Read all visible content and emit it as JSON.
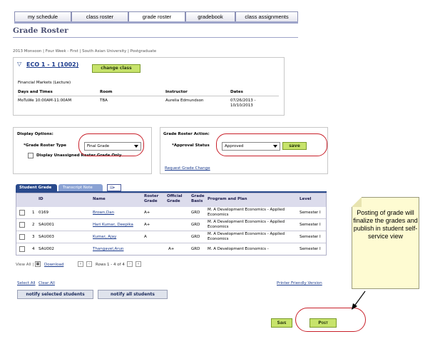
{
  "nav": {
    "tabs": [
      "my schedule",
      "class roster",
      "grade roster",
      "gradebook",
      "class assignments"
    ]
  },
  "page": {
    "title": "Grade Roster",
    "term": "2013 Monsoon | Four Week - First | South Asian University | Postgraduate"
  },
  "course": {
    "code": "ECO 1 - 1 (1002)",
    "change_class": "change class",
    "description": "Financial Markets (Lecture)",
    "headers": [
      "Days and Times",
      "Room",
      "Instructor",
      "Dates"
    ],
    "days_times": "MoTuWe 10:00AM-11:00AM",
    "room": "TBA",
    "instructor": "Aurelia Edmundson",
    "dates_1": "07/26/2013 -",
    "dates_2": "10/10/2013"
  },
  "display_options": {
    "heading": "Display Options:",
    "type_label": "*Grade Roster Type",
    "type_value": "Final Grade",
    "unassigned_label": "Display Unassigned Roster Grade Only"
  },
  "roster_action": {
    "heading": "Grade Roster Action:",
    "status_label": "*Approval Status",
    "status_value": "Approved",
    "save_label": "save",
    "request_change": "Request Grade Change"
  },
  "grid": {
    "tabs": [
      "Student Grade",
      "Transcript Note"
    ],
    "columns": [
      "ID",
      "Name",
      "Roster Grade",
      "Official Grade",
      "Grade Basis",
      "Program and Plan",
      "Level"
    ],
    "rows": [
      {
        "num": "1",
        "id": "0169",
        "name": "Brown,Dan",
        "roster": "A+",
        "official": "",
        "basis": "GRD",
        "program": "M. A Development Economics - Applied Economics",
        "level": "Semester I"
      },
      {
        "num": "2",
        "id": "SAU001",
        "name": "Hari Kumar, Deepika",
        "roster": "A+",
        "official": "",
        "basis": "GRD",
        "program": "M. A Development Economics - Applied Economics",
        "level": "Semester I"
      },
      {
        "num": "3",
        "id": "SAU003",
        "name": "Kumar, Ajay",
        "roster": "A",
        "official": "",
        "basis": "GRD",
        "program": "M. A Development Economics - Applied Economics",
        "level": "Semester I"
      },
      {
        "num": "4",
        "id": "SAU002",
        "name": "Thangavel,Arun",
        "roster": "",
        "official": "A+",
        "basis": "GRD",
        "program": "M. A Development Economics -",
        "level": "Semester I"
      }
    ],
    "view_all": "View All |",
    "download": "Download",
    "rows_info": "Rows 1 - 4 of 4"
  },
  "actions": {
    "select_all": "Select All",
    "clear_all": "Clear All",
    "printer_friendly": "Printer Friendly Version",
    "notify_selected": "notify selected students",
    "notify_all": "notify all students",
    "save": "Save",
    "post": "Post"
  },
  "callout": {
    "text": "Posting of grade will finalize the grades and publish in student self-service view"
  },
  "colors": {
    "accent_red": "#c8202a",
    "header_blue": "#2a4a8c",
    "button_green": "#c7e36b",
    "callout_yellow": "#fefbd2"
  }
}
